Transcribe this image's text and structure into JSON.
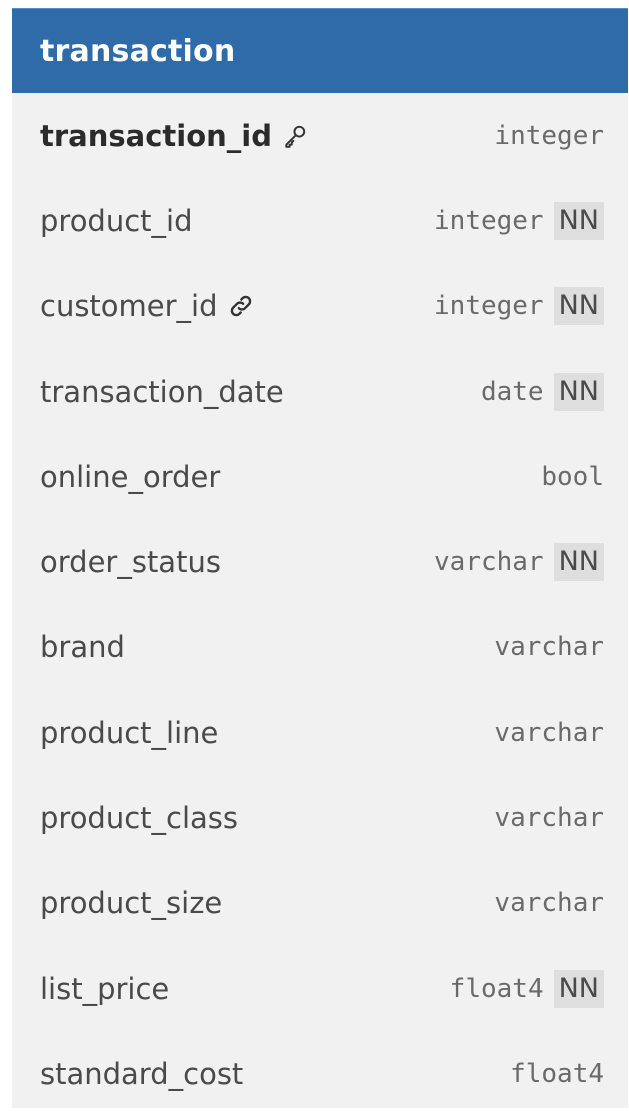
{
  "table": {
    "title": "transaction",
    "columns": [
      {
        "name": "transaction_id",
        "type": "integer",
        "nn": "",
        "icon": "key-icon",
        "pk": true
      },
      {
        "name": "product_id",
        "type": "integer",
        "nn": "NN",
        "icon": "",
        "pk": false
      },
      {
        "name": "customer_id",
        "type": "integer",
        "nn": "NN",
        "icon": "link-icon",
        "pk": false
      },
      {
        "name": "transaction_date",
        "type": "date",
        "nn": "NN",
        "icon": "",
        "pk": false
      },
      {
        "name": "online_order",
        "type": "bool",
        "nn": "",
        "icon": "",
        "pk": false
      },
      {
        "name": "order_status",
        "type": "varchar",
        "nn": "NN",
        "icon": "",
        "pk": false
      },
      {
        "name": "brand",
        "type": "varchar",
        "nn": "",
        "icon": "",
        "pk": false
      },
      {
        "name": "product_line",
        "type": "varchar",
        "nn": "",
        "icon": "",
        "pk": false
      },
      {
        "name": "product_class",
        "type": "varchar",
        "nn": "",
        "icon": "",
        "pk": false
      },
      {
        "name": "product_size",
        "type": "varchar",
        "nn": "",
        "icon": "",
        "pk": false
      },
      {
        "name": "list_price",
        "type": "float4",
        "nn": "NN",
        "icon": "",
        "pk": false
      },
      {
        "name": "standard_cost",
        "type": "float4",
        "nn": "",
        "icon": "",
        "pk": false
      }
    ]
  },
  "colors": {
    "header_bg": "#2f6ba8",
    "card_bg": "#f1f1f1",
    "nn_bg": "#dedede"
  }
}
